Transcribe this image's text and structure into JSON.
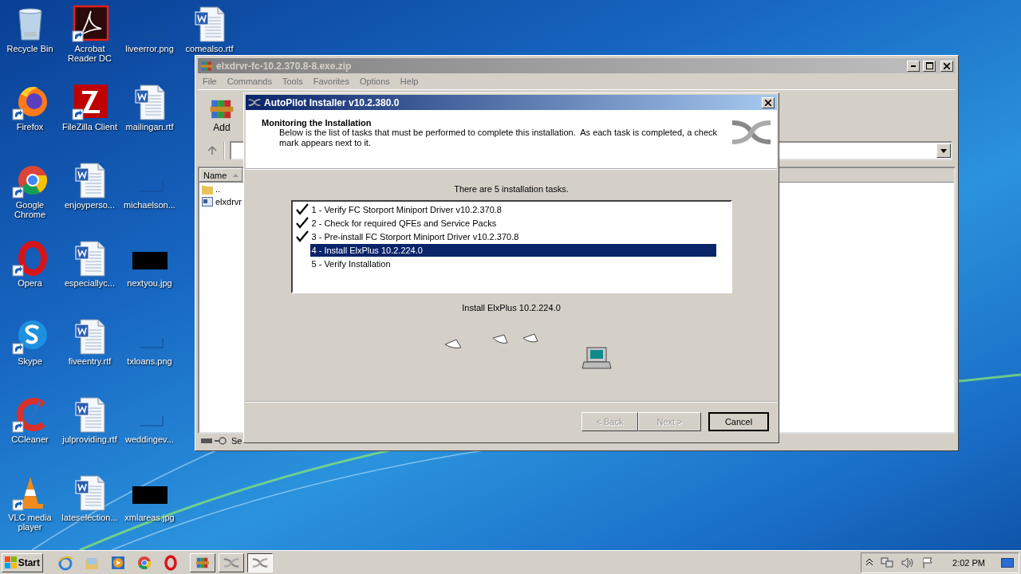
{
  "desktop_icons": [
    {
      "label": "Recycle Bin",
      "kind": "recycle",
      "shortcut": false
    },
    {
      "label": "Firefox",
      "kind": "firefox",
      "shortcut": true
    },
    {
      "label": "Google Chrome",
      "kind": "chrome",
      "shortcut": true
    },
    {
      "label": "Opera",
      "kind": "opera",
      "shortcut": true
    },
    {
      "label": "Skype",
      "kind": "skype",
      "shortcut": true
    },
    {
      "label": "CCleaner",
      "kind": "ccleaner",
      "shortcut": true
    },
    {
      "label": "VLC media player",
      "kind": "vlc",
      "shortcut": true
    },
    {
      "label": "Acrobat Reader DC",
      "kind": "acrobat",
      "shortcut": true
    },
    {
      "label": "FileZilla Client",
      "kind": "filezilla",
      "shortcut": true
    },
    {
      "label": "enjoyperso...",
      "kind": "word",
      "shortcut": false
    },
    {
      "label": "especiallyc...",
      "kind": "word",
      "shortcut": false
    },
    {
      "label": "fiveentry.rtf",
      "kind": "word",
      "shortcut": false
    },
    {
      "label": "julproviding.rtf",
      "kind": "word",
      "shortcut": false
    },
    {
      "label": "lateselection...",
      "kind": "word",
      "shortcut": false
    },
    {
      "label": "liveerror.png",
      "kind": "image",
      "shortcut": false
    },
    {
      "label": "mailingan.rtf",
      "kind": "word",
      "shortcut": false
    },
    {
      "label": "michaelson...",
      "kind": "image",
      "shortcut": false
    },
    {
      "label": "nextyou.jpg",
      "kind": "dark-image",
      "shortcut": false
    },
    {
      "label": "txloans.png",
      "kind": "image",
      "shortcut": false
    },
    {
      "label": "weddingev...",
      "kind": "image",
      "shortcut": false
    },
    {
      "label": "xmlareas.jpg",
      "kind": "dark-image",
      "shortcut": false
    },
    {
      "label": "comealso.rtf",
      "kind": "word",
      "shortcut": false
    }
  ],
  "archive_window": {
    "title": "elxdrvr-fc-10.2.370.8-8.exe.zip",
    "menu": [
      "File",
      "Commands",
      "Tools",
      "Favorites",
      "Options",
      "Help"
    ],
    "toolbar": [
      {
        "label": "Add"
      }
    ],
    "columns": [
      "Name"
    ],
    "files": [
      {
        "name": "..",
        "kind": "folder"
      },
      {
        "name": "elxdrvr",
        "kind": "exe"
      }
    ],
    "status": "Se"
  },
  "installer": {
    "title": "AutoPilot Installer v10.2.380.0",
    "heading": "Monitoring the Installation",
    "description": "Below is the list of tasks that must be performed to complete this installation.  As each task is completed, a check mark appears next to it.",
    "summary": "There are 5 installation tasks.",
    "tasks": [
      {
        "label": "1 - Verify FC Storport Miniport Driver v10.2.370.8",
        "done": true,
        "selected": false
      },
      {
        "label": "2 - Check for required QFEs and Service Packs",
        "done": true,
        "selected": false
      },
      {
        "label": "3 - Pre-install FC Storport Miniport Driver v10.2.370.8",
        "done": true,
        "selected": false
      },
      {
        "label": "4 - Install ElxPlus 10.2.224.0",
        "done": false,
        "selected": true
      },
      {
        "label": "5 - Verify Installation",
        "done": false,
        "selected": false
      }
    ],
    "current": "Install ElxPlus 10.2.224.0",
    "buttons": [
      {
        "label": "< Back",
        "disabled": true
      },
      {
        "label": "Next >",
        "disabled": true
      },
      {
        "label": "Cancel",
        "disabled": false
      }
    ]
  },
  "taskbar": {
    "start": "Start",
    "quick_launch": [
      {
        "kind": "ie"
      },
      {
        "kind": "explorer"
      },
      {
        "kind": "media"
      },
      {
        "kind": "chrome"
      },
      {
        "kind": "opera"
      }
    ],
    "tasks": [
      {
        "kind": "winrar",
        "selected": false
      },
      {
        "kind": "autopilot",
        "selected": false
      },
      {
        "kind": "autopilot",
        "selected": true
      }
    ],
    "clock": "2:02 PM"
  }
}
